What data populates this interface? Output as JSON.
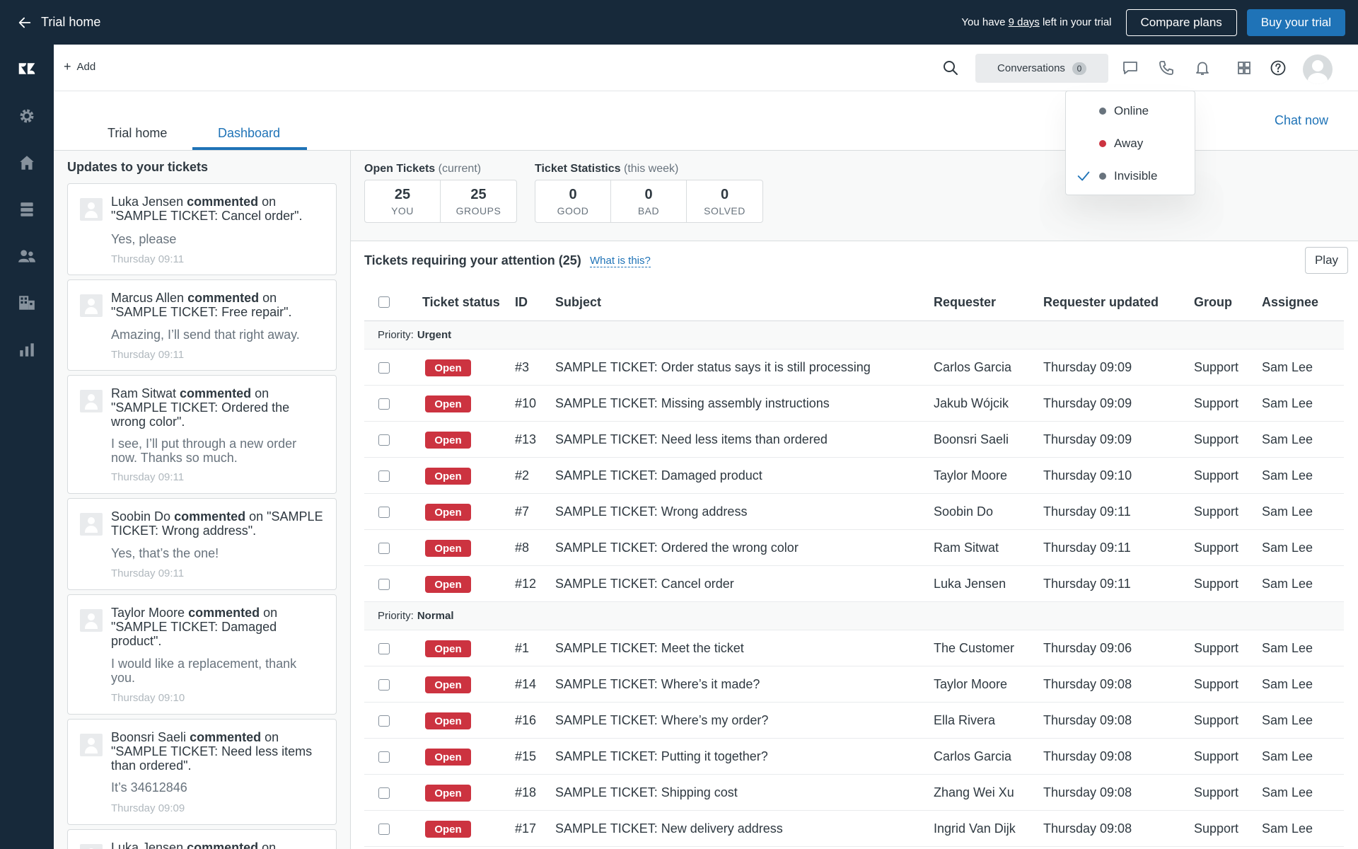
{
  "trialbar": {
    "back_label": "Trial home",
    "note_prefix": "You have ",
    "note_days": "9 days",
    "note_suffix": " left in your trial",
    "compare_label": "Compare plans",
    "buy_label": "Buy your trial"
  },
  "header": {
    "add_label": "Add",
    "conversations_label": "Conversations",
    "conversations_count": "0"
  },
  "tabs": [
    {
      "label": "Trial home"
    },
    {
      "label": "Dashboard"
    }
  ],
  "chat_now": "Chat now",
  "presence": [
    {
      "label": "Online",
      "color": "#68737d"
    },
    {
      "label": "Away",
      "color": "#cc3340"
    },
    {
      "label": "Invisible",
      "color": "#68737d",
      "checked": true
    }
  ],
  "updates": {
    "title": "Updates to your tickets",
    "items": [
      {
        "name": "Luka Jensen",
        "action": "commented",
        "on": " on",
        "ticket": "\"SAMPLE TICKET: Cancel order\".",
        "message": "Yes, please",
        "time": "Thursday 09:11"
      },
      {
        "name": "Marcus Allen",
        "action": "commented",
        "on": " on",
        "ticket": "\"SAMPLE TICKET: Free repair\".",
        "message": "Amazing, I’ll send that right away.",
        "time": "Thursday 09:11"
      },
      {
        "name": "Ram Sitwat",
        "action": "commented",
        "on": " on",
        "ticket": "\"SAMPLE TICKET: Ordered the wrong color\".",
        "message": "I see, I’ll put through a new order now. Thanks so much.",
        "time": "Thursday 09:11"
      },
      {
        "name": "Soobin Do",
        "action": "commented",
        "on": " on",
        "ticket": "\"SAMPLE TICKET: Wrong address\".",
        "message": "Yes, that’s the one!",
        "time": "Thursday 09:11"
      },
      {
        "name": "Taylor Moore",
        "action": "commented",
        "on": " on",
        "ticket": "\"SAMPLE TICKET: Damaged product\".",
        "message": "I would like a replacement, thank you.",
        "time": "Thursday 09:10"
      },
      {
        "name": "Boonsri Saeli",
        "action": "commented",
        "on": " on",
        "ticket": "\"SAMPLE TICKET: Need less items than ordered\".",
        "message": "It’s 34612846",
        "time": "Thursday 09:09"
      },
      {
        "name": "Luka Jensen",
        "action": "commented",
        "on": " on",
        "ticket": "",
        "message": "",
        "time": ""
      }
    ]
  },
  "stats": {
    "open_title": "Open Tickets",
    "open_sub": "(current)",
    "open": [
      {
        "num": "25",
        "label": "YOU"
      },
      {
        "num": "25",
        "label": "GROUPS"
      }
    ],
    "stat_title": "Ticket Statistics",
    "stat_sub": "(this week)",
    "stat": [
      {
        "num": "0",
        "label": "GOOD"
      },
      {
        "num": "0",
        "label": "BAD"
      },
      {
        "num": "0",
        "label": "SOLVED"
      }
    ]
  },
  "attention": {
    "title": "Tickets requiring your attention (25)",
    "what": "What is this?",
    "play": "Play"
  },
  "table": {
    "headers": {
      "status": "Ticket status",
      "id": "ID",
      "subject": "Subject",
      "requester": "Requester",
      "updated": "Requester updated",
      "group": "Group",
      "assignee": "Assignee"
    },
    "groups": [
      {
        "prefix": "Priority:",
        "name": "Urgent",
        "rows": [
          {
            "status": "Open",
            "id": "#3",
            "subject": "SAMPLE TICKET: Order status says it is still processing",
            "requester": "Carlos Garcia",
            "updated": "Thursday 09:09",
            "group": "Support",
            "assignee": "Sam Lee"
          },
          {
            "status": "Open",
            "id": "#10",
            "subject": "SAMPLE TICKET: Missing assembly instructions",
            "requester": "Jakub Wójcik",
            "updated": "Thursday 09:09",
            "group": "Support",
            "assignee": "Sam Lee"
          },
          {
            "status": "Open",
            "id": "#13",
            "subject": "SAMPLE TICKET: Need less items than ordered",
            "requester": "Boonsri Saeli",
            "updated": "Thursday 09:09",
            "group": "Support",
            "assignee": "Sam Lee"
          },
          {
            "status": "Open",
            "id": "#2",
            "subject": "SAMPLE TICKET: Damaged product",
            "requester": "Taylor Moore",
            "updated": "Thursday 09:10",
            "group": "Support",
            "assignee": "Sam Lee"
          },
          {
            "status": "Open",
            "id": "#7",
            "subject": "SAMPLE TICKET: Wrong address",
            "requester": "Soobin Do",
            "updated": "Thursday 09:11",
            "group": "Support",
            "assignee": "Sam Lee"
          },
          {
            "status": "Open",
            "id": "#8",
            "subject": "SAMPLE TICKET: Ordered the wrong color",
            "requester": "Ram Sitwat",
            "updated": "Thursday 09:11",
            "group": "Support",
            "assignee": "Sam Lee"
          },
          {
            "status": "Open",
            "id": "#12",
            "subject": "SAMPLE TICKET: Cancel order",
            "requester": "Luka Jensen",
            "updated": "Thursday 09:11",
            "group": "Support",
            "assignee": "Sam Lee"
          }
        ]
      },
      {
        "prefix": "Priority:",
        "name": "Normal",
        "rows": [
          {
            "status": "Open",
            "id": "#1",
            "subject": "SAMPLE TICKET: Meet the ticket",
            "requester": "The Customer",
            "updated": "Thursday 09:06",
            "group": "Support",
            "assignee": "Sam Lee"
          },
          {
            "status": "Open",
            "id": "#14",
            "subject": "SAMPLE TICKET: Where’s it made?",
            "requester": "Taylor Moore",
            "updated": "Thursday 09:08",
            "group": "Support",
            "assignee": "Sam Lee"
          },
          {
            "status": "Open",
            "id": "#16",
            "subject": "SAMPLE TICKET: Where’s my order?",
            "requester": "Ella Rivera",
            "updated": "Thursday 09:08",
            "group": "Support",
            "assignee": "Sam Lee"
          },
          {
            "status": "Open",
            "id": "#15",
            "subject": "SAMPLE TICKET: Putting it together?",
            "requester": "Carlos Garcia",
            "updated": "Thursday 09:08",
            "group": "Support",
            "assignee": "Sam Lee"
          },
          {
            "status": "Open",
            "id": "#18",
            "subject": "SAMPLE TICKET: Shipping cost",
            "requester": "Zhang Wei Xu",
            "updated": "Thursday 09:08",
            "group": "Support",
            "assignee": "Sam Lee"
          },
          {
            "status": "Open",
            "id": "#17",
            "subject": "SAMPLE TICKET: New delivery address",
            "requester": "Ingrid Van Dijk",
            "updated": "Thursday 09:08",
            "group": "Support",
            "assignee": "Sam Lee"
          }
        ]
      }
    ]
  },
  "icons": {
    "nav": [
      "zendesk-logo-icon",
      "gear-icon",
      "home-icon",
      "views-icon",
      "customers-icon",
      "organizations-icon",
      "reporting-icon"
    ],
    "header": [
      "search-icon",
      "chat-bubble-icon",
      "phone-icon",
      "bell-icon",
      "apps-grid-icon",
      "help-icon"
    ]
  }
}
